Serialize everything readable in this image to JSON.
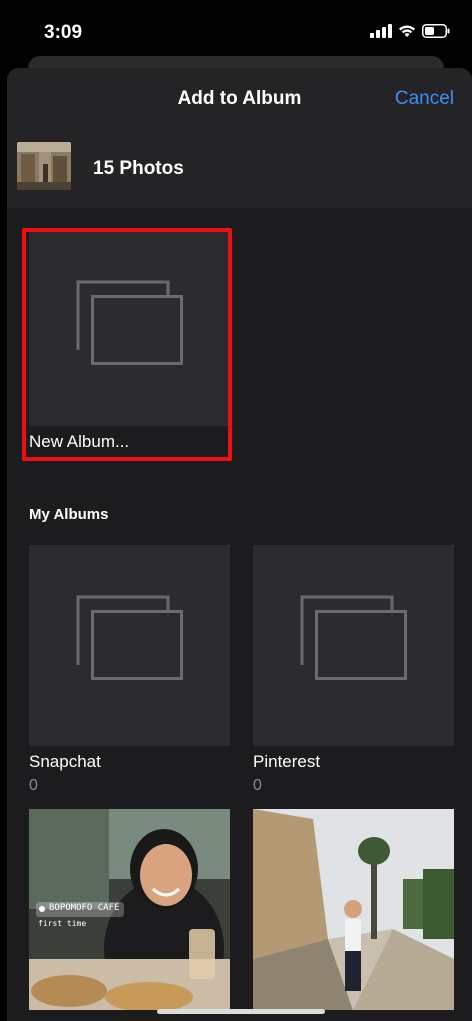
{
  "status": {
    "time": "3:09"
  },
  "header": {
    "title": "Add to Album",
    "cancel_label": "Cancel"
  },
  "selection": {
    "count_label": "15 Photos"
  },
  "new_album": {
    "label": "New Album..."
  },
  "my_albums": {
    "section_label": "My Albums",
    "albums": [
      {
        "name": "Snapchat",
        "count": "0"
      },
      {
        "name": "Pinterest",
        "count": "0"
      }
    ],
    "photo_sticker": {
      "place": "BOPOMOFO CAFE",
      "caption": "first time"
    }
  },
  "colors": {
    "accent": "#3d8ef7",
    "highlight": "#f00f0f",
    "sheet": "#1c1c1e",
    "tile": "#2c2c2e"
  }
}
